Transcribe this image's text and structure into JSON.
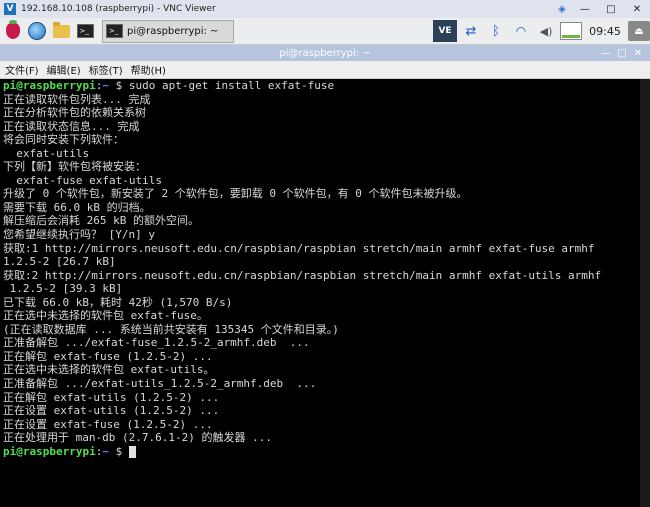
{
  "vnc": {
    "title": "192.168.10.108 (raspberrypi) - VNC Viewer",
    "logo": "V",
    "controls": [
      "—",
      "□",
      "✕"
    ],
    "extra_icon": "vnc-extra-icon"
  },
  "taskbar": {
    "task_label": "pi@raspberrypi: ~",
    "clock": "09:45",
    "ve_label": "VE",
    "icons": [
      "raspberry-menu-icon",
      "web-browser-icon",
      "file-manager-icon",
      "terminal-icon"
    ]
  },
  "terminal_window": {
    "title": "pi@raspberrypi: ~",
    "controls": [
      "—",
      "□",
      "✕"
    ],
    "menu": [
      "文件(F)",
      "编辑(E)",
      "标签(T)",
      "帮助(H)"
    ]
  },
  "prompt": {
    "user_host": "pi@raspberrypi",
    "sep": ":",
    "path": "~",
    "sym": " $ "
  },
  "lines": [
    {
      "prompt": true,
      "text": "sudo apt-get install exfat-fuse"
    },
    {
      "text": "正在读取软件包列表... 完成"
    },
    {
      "text": "正在分析软件包的依赖关系树"
    },
    {
      "text": "正在读取状态信息... 完成"
    },
    {
      "text": "将会同时安装下列软件："
    },
    {
      "text": "  exfat-utils"
    },
    {
      "text": "下列【新】软件包将被安装："
    },
    {
      "text": "  exfat-fuse exfat-utils"
    },
    {
      "text": "升级了 0 个软件包，新安装了 2 个软件包，要卸载 0 个软件包，有 0 个软件包未被升级。"
    },
    {
      "text": "需要下载 66.0 kB 的归档。"
    },
    {
      "text": "解压缩后会消耗 265 kB 的额外空间。"
    },
    {
      "text": "您希望继续执行吗？ [Y/n] y"
    },
    {
      "text": "获取:1 http://mirrors.neusoft.edu.cn/raspbian/raspbian stretch/main armhf exfat-fuse armhf"
    },
    {
      "text": "1.2.5-2 [26.7 kB]"
    },
    {
      "text": "获取:2 http://mirrors.neusoft.edu.cn/raspbian/raspbian stretch/main armhf exfat-utils armhf"
    },
    {
      "text": " 1.2.5-2 [39.3 kB]"
    },
    {
      "text": "已下载 66.0 kB，耗时 42秒 (1,570 B/s)"
    },
    {
      "text": "正在选中未选择的软件包 exfat-fuse。"
    },
    {
      "text": "(正在读取数据库 ... 系统当前共安装有 135345 个文件和目录。)"
    },
    {
      "text": "正准备解包 .../exfat-fuse_1.2.5-2_armhf.deb  ..."
    },
    {
      "text": "正在解包 exfat-fuse (1.2.5-2) ..."
    },
    {
      "text": "正在选中未选择的软件包 exfat-utils。"
    },
    {
      "text": "正准备解包 .../exfat-utils_1.2.5-2_armhf.deb  ..."
    },
    {
      "text": "正在解包 exfat-utils (1.2.5-2) ..."
    },
    {
      "text": "正在设置 exfat-utils (1.2.5-2) ..."
    },
    {
      "text": "正在设置 exfat-fuse (1.2.5-2) ..."
    },
    {
      "text": "正在处理用于 man-db (2.7.6.1-2) 的触发器 ..."
    },
    {
      "prompt": true,
      "text": "",
      "cursor": true
    }
  ]
}
